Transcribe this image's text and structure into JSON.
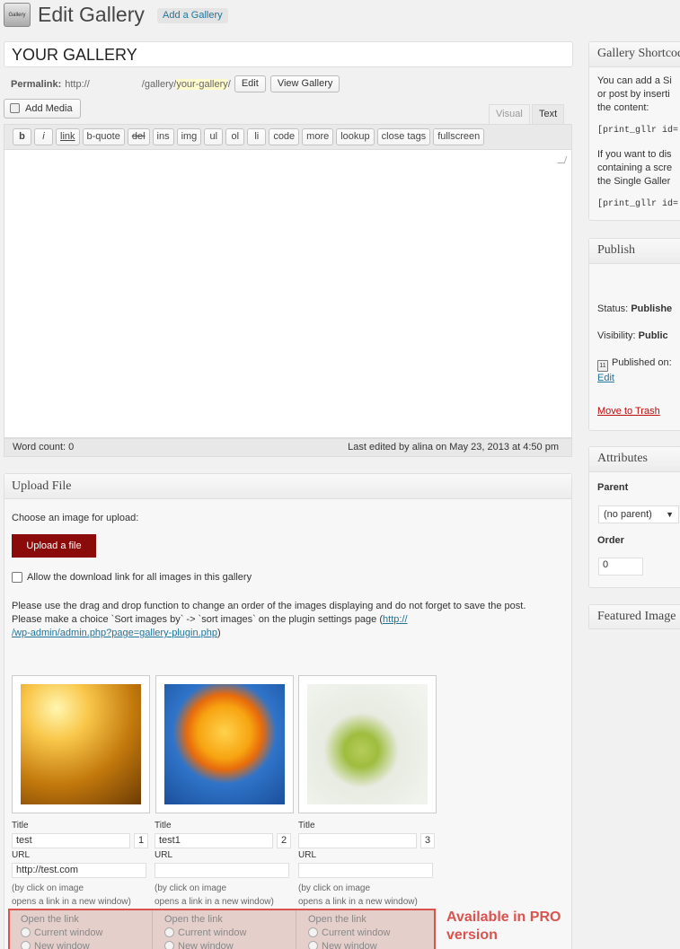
{
  "header": {
    "logo_text": "Gallery",
    "title": "Edit Gallery",
    "add_new": "Add a Gallery"
  },
  "post": {
    "title_value": "YOUR GALLERY",
    "permalink_label": "Permalink:",
    "permalink_prefix": "http://",
    "permalink_path": "/gallery/",
    "permalink_slug": "your-gallery",
    "permalink_suffix": "/",
    "edit_button": "Edit",
    "view_button": "View Gallery"
  },
  "editor": {
    "add_media": "Add Media",
    "tabs": {
      "visual": "Visual",
      "text": "Text"
    },
    "quicktags": [
      "b",
      "i",
      "link",
      "b-quote",
      "del",
      "ins",
      "img",
      "ul",
      "ol",
      "li",
      "code",
      "more",
      "lookup",
      "close tags",
      "fullscreen"
    ],
    "word_count": "Word count: 0",
    "last_edited": "Last edited by alina on May 23, 2013 at 4:50 pm"
  },
  "upload": {
    "heading": "Upload File",
    "choose_label": "Choose an image for upload:",
    "upload_button": "Upload a file",
    "download_checkbox": "Allow the download link for all images in this gallery",
    "info_line1": "Please use the drag and drop function to change an order of the images displaying and do not forget to save the post.",
    "info_line2": "Please make a choice `Sort images by` -> `sort images` on the plugin settings page (",
    "info_link_a": "http://",
    "info_link_b": "/wp-admin/admin.php?page=gallery-plugin.php",
    "info_close": ")",
    "title_label": "Title",
    "url_label": "URL",
    "url_hint_1": "(by click on image",
    "url_hint_2": "opens a link in a new window)",
    "open_link_label": "Open the link",
    "current_window": "Current window",
    "new_window": "New window",
    "pro_note": "Available in PRO version",
    "images": [
      {
        "title": "test",
        "order": "1",
        "url": "http://test.com"
      },
      {
        "title": "test1",
        "order": "2",
        "url": ""
      },
      {
        "title": "",
        "order": "3",
        "url": ""
      }
    ]
  },
  "sidebar": {
    "shortcode": {
      "heading": "Gallery Shortcode",
      "text1_l1": "You can add a Si",
      "text1_l2": "or post by inserti",
      "text1_l3": "the content:",
      "code1": "[print_gllr id=",
      "text2_l1": "If you want to dis",
      "text2_l2": "containing a scre",
      "text2_l3": "the Single Galler",
      "code2": "[print_gllr id="
    },
    "publish": {
      "heading": "Publish",
      "status_label": "Status:",
      "status_value": "Publishe",
      "visibility_label": "Visibility:",
      "visibility_value": "Public",
      "published_on": "Published on:",
      "edit_link": "Edit",
      "trash": "Move to Trash"
    },
    "attributes": {
      "heading": "Attributes",
      "parent_label": "Parent",
      "parent_value": "(no parent)",
      "order_label": "Order",
      "order_value": "0"
    },
    "featured": {
      "heading": "Featured Image"
    }
  }
}
